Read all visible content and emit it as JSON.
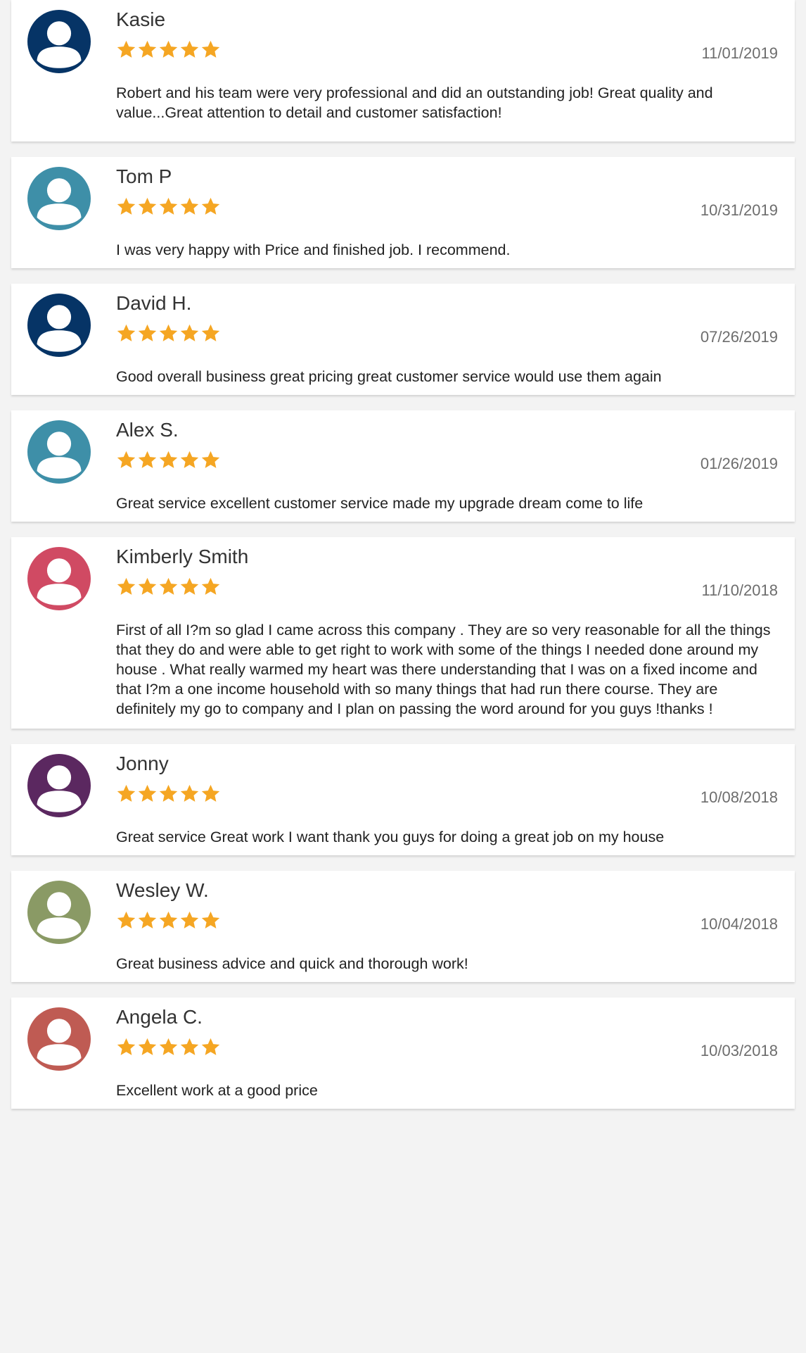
{
  "colors": {
    "star": "#f5a623",
    "page_background": "#f3f3f3",
    "card_background": "#ffffff"
  },
  "icons": {
    "avatar": "person-icon",
    "rating": "star-icon"
  },
  "reviews": [
    {
      "name": "Kasie",
      "rating": 5,
      "date": "11/01/2019",
      "text": "Robert and his team were very professional and did an outstanding job! Great quality and value...Great attention to detail and customer satisfaction!",
      "avatar_color": "#063466"
    },
    {
      "name": "Tom P",
      "rating": 5,
      "date": "10/31/2019",
      "text": "I was very happy with Price and finished job. I recommend.",
      "avatar_color": "#3e8fa8"
    },
    {
      "name": "David H.",
      "rating": 5,
      "date": "07/26/2019",
      "text": "Good overall business great pricing great customer service would use them again",
      "avatar_color": "#063466"
    },
    {
      "name": "Alex S.",
      "rating": 5,
      "date": "01/26/2019",
      "text": "Great service excellent customer service made my upgrade dream come to life",
      "avatar_color": "#3e8fa8"
    },
    {
      "name": "Kimberly Smith",
      "rating": 5,
      "date": "11/10/2018",
      "text": "First of all I?m so glad I came across this company . They are so very reasonable for all the things that they do and were able to get right to work with some of the things I needed done around my house . What really warmed my heart was there understanding that I was on a fixed income and that I?m a one income household with so many things that had run there course. They are definitely my go to company and I plan on passing the word around for you guys !thanks !",
      "avatar_color": "#d04a63"
    },
    {
      "name": "Jonny",
      "rating": 5,
      "date": "10/08/2018",
      "text": "Great service Great work I want thank you guys for doing a great job on my house",
      "avatar_color": "#5b2860"
    },
    {
      "name": "Wesley W.",
      "rating": 5,
      "date": "10/04/2018",
      "text": "Great business advice and quick and thorough work!",
      "avatar_color": "#8a9a65"
    },
    {
      "name": "Angela C.",
      "rating": 5,
      "date": "10/03/2018",
      "text": "Excellent work at a good price",
      "avatar_color": "#bf5b53"
    }
  ]
}
